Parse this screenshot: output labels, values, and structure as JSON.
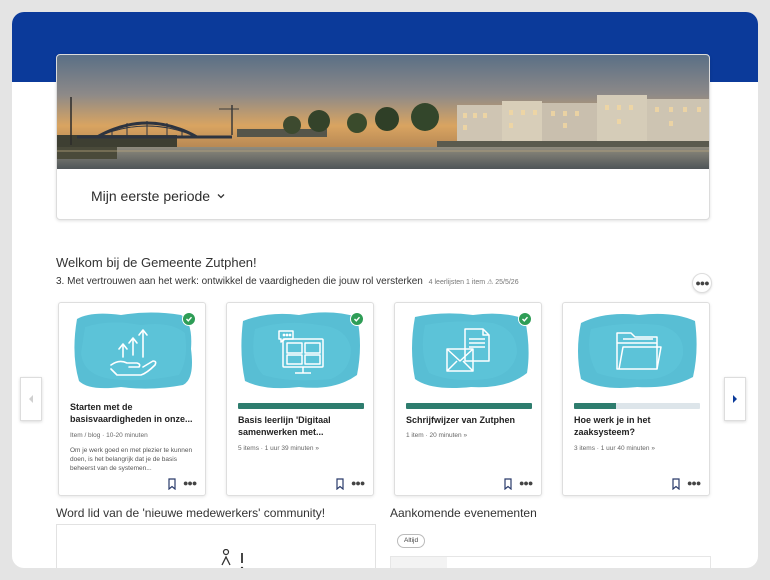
{
  "header": {
    "color": "#0b3a9a"
  },
  "hero": {
    "period_label": "Mijn eerste periode",
    "period_icon": "chevron-down-icon"
  },
  "main": {
    "welcome": "Welkom bij de Gemeente Zutphen!",
    "learning_path": {
      "title": "3. Met vertrouwen aan het werk: ontwikkel de vaardigheden die jouw rol versterken",
      "meta": "4 leerlijsten 1 item ⚠ 25/5/26"
    }
  },
  "cards": [
    {
      "icon": "growth-hand-icon",
      "completed": true,
      "title": "Starten met de basisvaardigheden in onze...",
      "meta": "Item / blog · 10-20 minuten",
      "description": "Om je werk goed en met plezier te kunnen doen, is het belangrijk dat je de basis beheerst van de systemen..."
    },
    {
      "icon": "monitor-meeting-icon",
      "completed": true,
      "progress": 1.0,
      "title": "Basis leerlijn 'Digitaal samenwerken met...",
      "meta": "5 items · 1 uur 39 minuten »"
    },
    {
      "icon": "mail-document-icon",
      "completed": true,
      "progress": 1.0,
      "title": "Schrijfwijzer van Zutphen",
      "meta": "1 item · 20 minuten »"
    },
    {
      "icon": "folder-icon",
      "completed": false,
      "progress": 0.33,
      "title": "Hoe werk je in het zaaksysteem?",
      "meta": "3 items · 1 uur 40 minuten »"
    }
  ],
  "community": {
    "title": "Word lid van de 'nieuwe medewerkers' community!"
  },
  "events": {
    "title": "Aankomende evenementen",
    "filter": "Altijd"
  },
  "colors": {
    "progress": "#2e7d6e",
    "check": "#2e9d56",
    "watercolor": "#3bb3cc"
  }
}
